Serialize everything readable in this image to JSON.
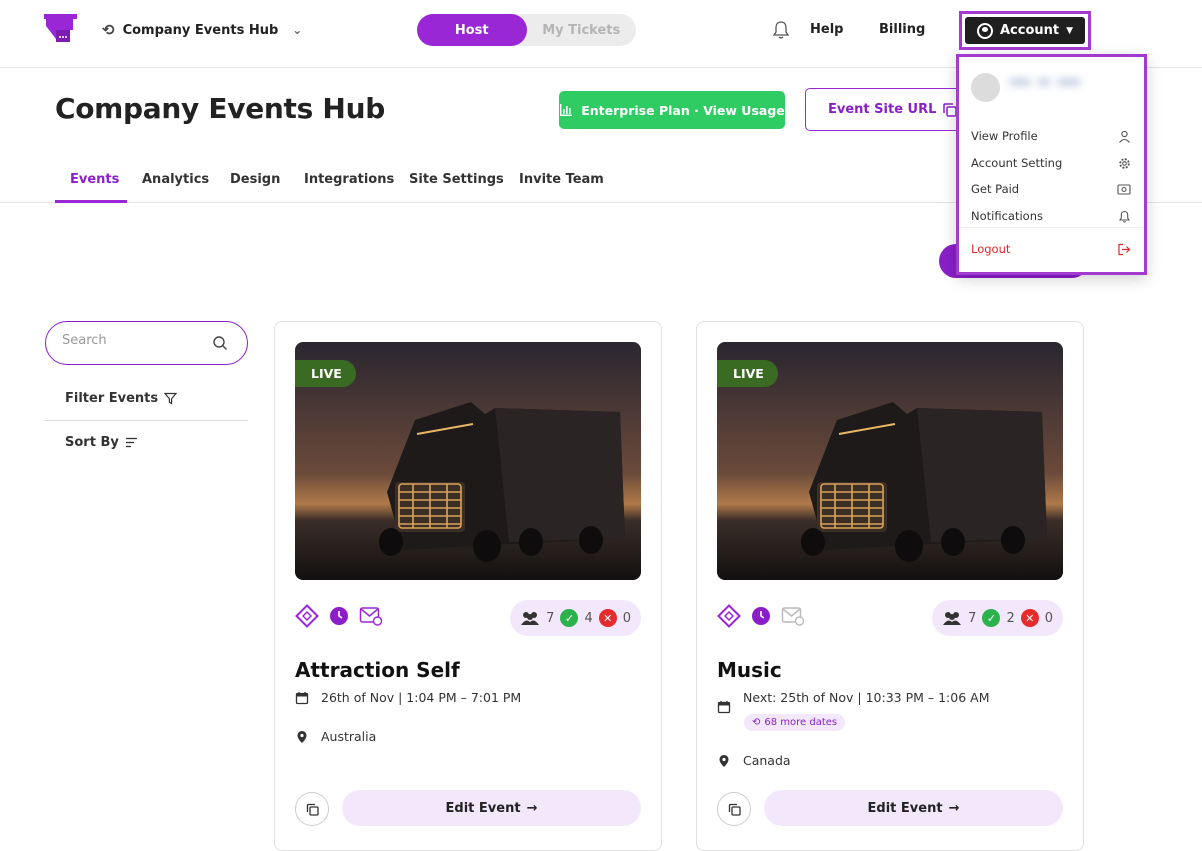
{
  "header": {
    "org_name": "Company Events Hub",
    "toggle": [
      "Host",
      "My Tickets"
    ],
    "help": "Help",
    "billing": "Billing",
    "account": "Account"
  },
  "page": {
    "title": "Company Events Hub",
    "plan_button": "Enterprise Plan · View Usage",
    "site_button": "Event Site URL"
  },
  "tabs": [
    "Events",
    "Analytics",
    "Design",
    "Integrations",
    "Site Settings",
    "Invite Team"
  ],
  "sidebar": {
    "search_placeholder": "Search",
    "filter_label": "Filter Events",
    "sort_label": "Sort By"
  },
  "events": [
    {
      "status": "LIVE",
      "attendees": "7",
      "checked_in": "4",
      "cancelled": "0",
      "title": "Attraction Self",
      "date": "26th of Nov | 1:04 PM – 7:01 PM",
      "location": "Australia",
      "edit_label": "Edit Event"
    },
    {
      "status": "LIVE",
      "attendees": "7",
      "checked_in": "2",
      "cancelled": "0",
      "title": "Music",
      "date": "Next: 25th of Nov | 10:33 PM – 1:06 AM",
      "more_dates": "68 more dates",
      "location": "Canada",
      "edit_label": "Edit Event"
    }
  ],
  "account_menu": {
    "items": [
      "View Profile",
      "Account Setting",
      "Get Paid",
      "Notifications"
    ],
    "logout": "Logout"
  },
  "colors": {
    "brand_purple": "#9a27d6",
    "plan_green": "#2ecc63",
    "live_green": "#3a6b22",
    "logout_red": "#e02a2a"
  }
}
